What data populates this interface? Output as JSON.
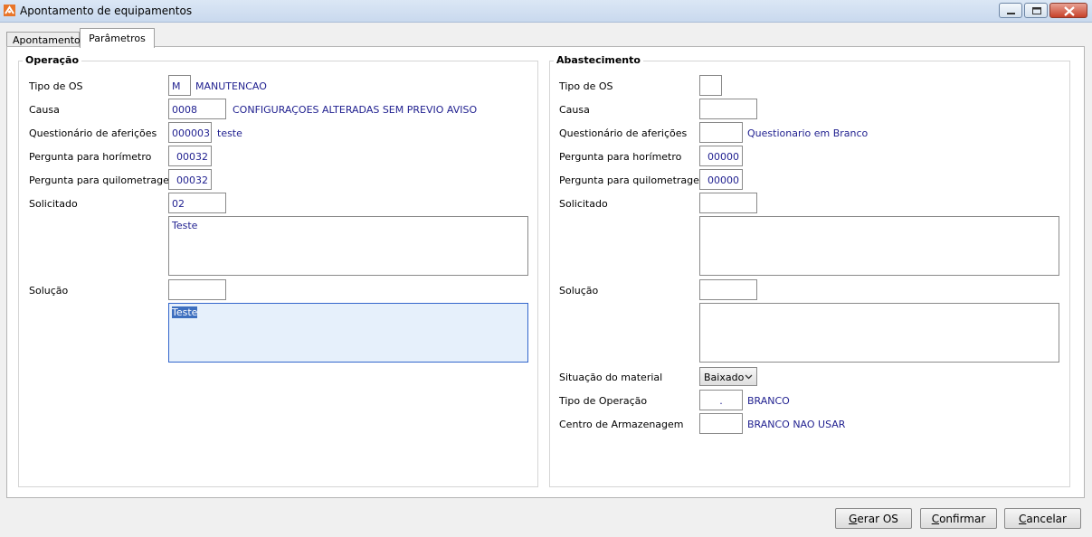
{
  "window": {
    "title": "Apontamento de equipamentos",
    "colors": {
      "titlebar": "#dbe7f5",
      "close": "#c7412a"
    }
  },
  "tabs": [
    {
      "label": "Apontamentos",
      "active": false
    },
    {
      "label": "Parâmetros",
      "active": true
    }
  ],
  "operacao": {
    "legend": "Operação",
    "tipo_os": {
      "label": "Tipo de OS",
      "value": "M",
      "desc": "MANUTENCAO"
    },
    "causa": {
      "label": "Causa",
      "value": "0008",
      "desc": "CONFIGURAÇOES ALTERADAS SEM PREVIO AVISO"
    },
    "questionario": {
      "label": "Questionário de aferições",
      "value": "000003",
      "desc": "teste"
    },
    "pergunta_horimetro": {
      "label": "Pergunta para horímetro",
      "value": "00032"
    },
    "pergunta_quilometragem": {
      "label": "Pergunta para quilometragem",
      "value": "00032"
    },
    "solicitado": {
      "label": "Solicitado",
      "value": "02",
      "memo": "Teste"
    },
    "solucao": {
      "label": "Solução",
      "value": "",
      "memo": "Teste"
    }
  },
  "abastecimento": {
    "legend": "Abastecimento",
    "tipo_os": {
      "label": "Tipo de OS",
      "value": ""
    },
    "causa": {
      "label": "Causa",
      "value": ""
    },
    "questionario": {
      "label": "Questionário de aferições",
      "value": "",
      "desc": "Questionario em Branco"
    },
    "pergunta_horimetro": {
      "label": "Pergunta para horímetro",
      "value": "00000"
    },
    "pergunta_quilometragem": {
      "label": "Pergunta para quilometragem",
      "value": "00000"
    },
    "solicitado": {
      "label": "Solicitado",
      "value": "",
      "memo": ""
    },
    "solucao": {
      "label": "Solução",
      "value": "",
      "memo": ""
    },
    "situacao_material": {
      "label": "Situação do material",
      "value": "Baixado"
    },
    "tipo_operacao": {
      "label": "Tipo de Operação",
      "value": ".",
      "desc": "BRANCO"
    },
    "centro_armazenagem": {
      "label": "Centro de Armazenagem",
      "value": "",
      "desc": "BRANCO NAO USAR"
    }
  },
  "buttons": {
    "gerar_os": {
      "first": "G",
      "rest": "erar OS"
    },
    "confirmar": {
      "first": "C",
      "rest": "onfirmar"
    },
    "cancelar": {
      "first": "C",
      "rest": "ancelar"
    }
  },
  "icons": [
    "app-icon",
    "minimize-icon",
    "maximize-icon",
    "close-icon",
    "chevron-down-icon"
  ]
}
